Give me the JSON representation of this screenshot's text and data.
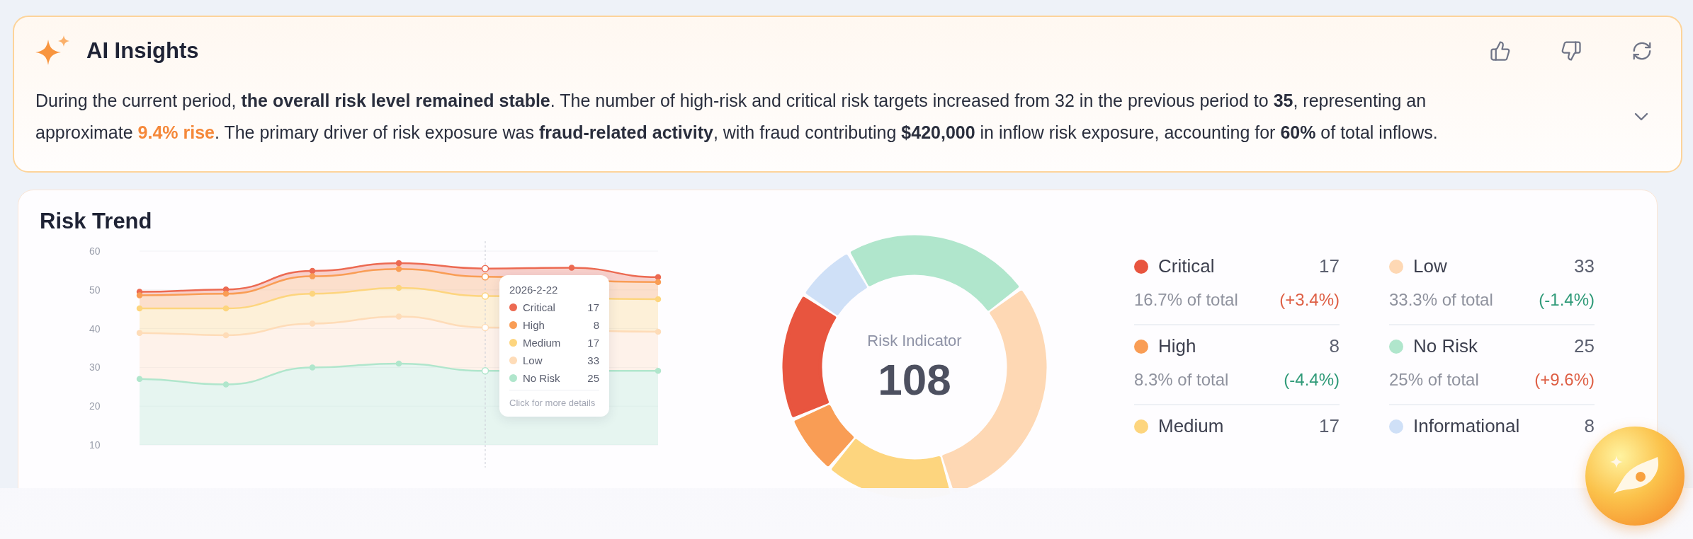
{
  "insights": {
    "title": "AI Insights",
    "paragraph": [
      {
        "kind": "plain",
        "text": "During the current period, "
      },
      {
        "kind": "bold",
        "text": "the overall risk level remained stable"
      },
      {
        "kind": "plain",
        "text": ". The number of high-risk and critical risk targets increased from 32 in the previous period to "
      },
      {
        "kind": "bold",
        "text": "35"
      },
      {
        "kind": "plain",
        "text": ", representing an approximate "
      },
      {
        "kind": "accent",
        "text": "9.4% rise"
      },
      {
        "kind": "plain",
        "text": ". The primary driver of risk exposure was "
      },
      {
        "kind": "bold",
        "text": "fraud-related activity"
      },
      {
        "kind": "plain",
        "text": ", with fraud contributing "
      },
      {
        "kind": "bold",
        "text": "$420,000"
      },
      {
        "kind": "plain",
        "text": " in inflow risk exposure, accounting for "
      },
      {
        "kind": "bold",
        "text": "60%"
      },
      {
        "kind": "plain",
        "text": " of total inflows."
      }
    ]
  },
  "risk_trend": {
    "title": "Risk Trend",
    "chart_data": {
      "type": "area",
      "yticks": [
        10,
        20,
        30,
        40,
        50,
        60
      ],
      "ylim": [
        10,
        60
      ],
      "grid": true,
      "legend": "upper right",
      "series": [
        {
          "name": "Critical",
          "color": "#ec6a52",
          "marker": "circle",
          "values": [
            49.5,
            50.1,
            54.9,
            56.9,
            55.5,
            55.7,
            53.3
          ]
        },
        {
          "name": "High",
          "color": "#f99d55",
          "marker": "circle",
          "values": [
            48.6,
            49.0,
            53.5,
            55.4,
            53.4,
            null,
            52.0
          ]
        },
        {
          "name": "Medium",
          "color": "#fdd57e",
          "marker": "circle",
          "values": [
            45.2,
            45.2,
            49.0,
            50.5,
            48.4,
            null,
            47.6
          ]
        },
        {
          "name": "Low",
          "color": "#fedcb8",
          "marker": "circle",
          "values": [
            38.9,
            38.3,
            41.3,
            43.1,
            40.3,
            null,
            39.2
          ]
        },
        {
          "name": "No Risk",
          "color": "#b0e6cc",
          "marker": "circle",
          "values": [
            27.0,
            25.6,
            30.0,
            31.0,
            29.1,
            null,
            29.1
          ]
        }
      ]
    },
    "tooltip": {
      "date": "2026-2-22",
      "values": [
        "17",
        "8",
        "17",
        "33",
        "25"
      ],
      "footer": "Click for more details"
    },
    "indicator": {
      "label": "Risk Indicator",
      "value": "108"
    },
    "categories": [
      {
        "name": "Critical",
        "color": "#e8553f",
        "count": "17",
        "share": "16.7% of total",
        "change": "(+3.4%)",
        "kind": "increase"
      },
      {
        "name": "Low",
        "color": "#fed8b4",
        "count": "33",
        "share": "33.3% of total",
        "change": "(-1.4%)",
        "kind": "decrease"
      },
      {
        "name": "High",
        "color": "#f99d55",
        "count": "8",
        "share": "8.3% of total",
        "change": "(-4.4%)",
        "kind": "decrease"
      },
      {
        "name": "No Risk",
        "color": "#b0e6cc",
        "count": "25",
        "share": "25% of total",
        "change": "(+9.6%)",
        "kind": "increase"
      },
      {
        "name": "Medium",
        "color": "#fdd57e",
        "count": "17"
      },
      {
        "name": "Informational",
        "color": "#cfe0f7",
        "count": "8"
      }
    ]
  }
}
